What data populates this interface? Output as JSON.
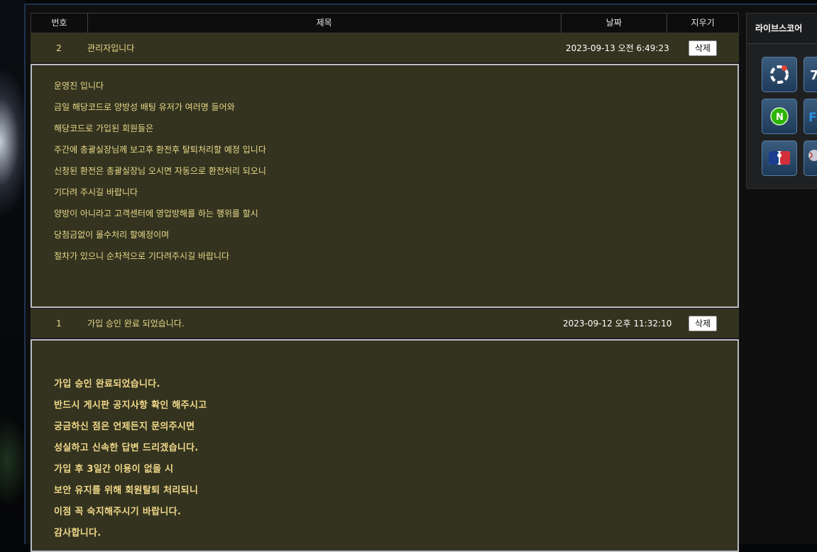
{
  "table": {
    "headers": {
      "number": "번호",
      "title": "제목",
      "date": "날짜",
      "delete": "지우기"
    }
  },
  "posts": [
    {
      "number": "2",
      "title": "관리자입니다",
      "date": "2023-09-13 오전 6:49:23",
      "delete_label": "삭제",
      "body": [
        "운영진 입니다",
        "금일 해당코드로 양방성 배팅 유저가 여러명 들어와",
        "해당코드로 가입된 회원들은",
        "주간에 총괄실장님께 보고후 환전후 탈퇴처리할 예정 입니다",
        "신청된 환전은 총괄실장님 오시면 자동으로 환전처리 되오니",
        "기다려 주시길 바랍니다",
        "양방이 아니라고 고객센터에 영업방해를 하는 행위를 할시",
        "당첨금없이 몰수처리 할예정이며",
        "절차가 있으니 순차적으로 기다려주시길 바랍니다"
      ]
    },
    {
      "number": "1",
      "title": "가입 승인 완료 되었습니다.",
      "date": "2023-09-12 오후 11:32:10",
      "delete_label": "삭제",
      "body": [
        "가입 승인 완료되었습니다.",
        "반드시 게시판 공지사항 확인 해주시고",
        "궁금하신 점은 언제든지 문의주시면",
        "성실하고 신속한 답변 드리겠습니다.",
        "가입 후 3일간 이용이 없을 시",
        "보안 유지를 위해 회원탈퇴 처리되니",
        "이점 꼭 숙지해주시기 바랍니다.",
        "감사합니다."
      ]
    }
  ],
  "sidebar": {
    "title": "라이브스코어",
    "tiles": [
      {
        "icon": "refresh-score-icon"
      },
      {
        "icon": "score-site-icon"
      },
      {
        "icon": "naver-sports-icon"
      },
      {
        "icon": "flashscore-icon"
      },
      {
        "icon": "mlb-icon"
      },
      {
        "icon": "baseball-site-icon"
      }
    ]
  },
  "colors": {
    "row_bg": "#33331f",
    "text_yellow": "#e9d98a",
    "border_light": "#b9bcc2"
  }
}
